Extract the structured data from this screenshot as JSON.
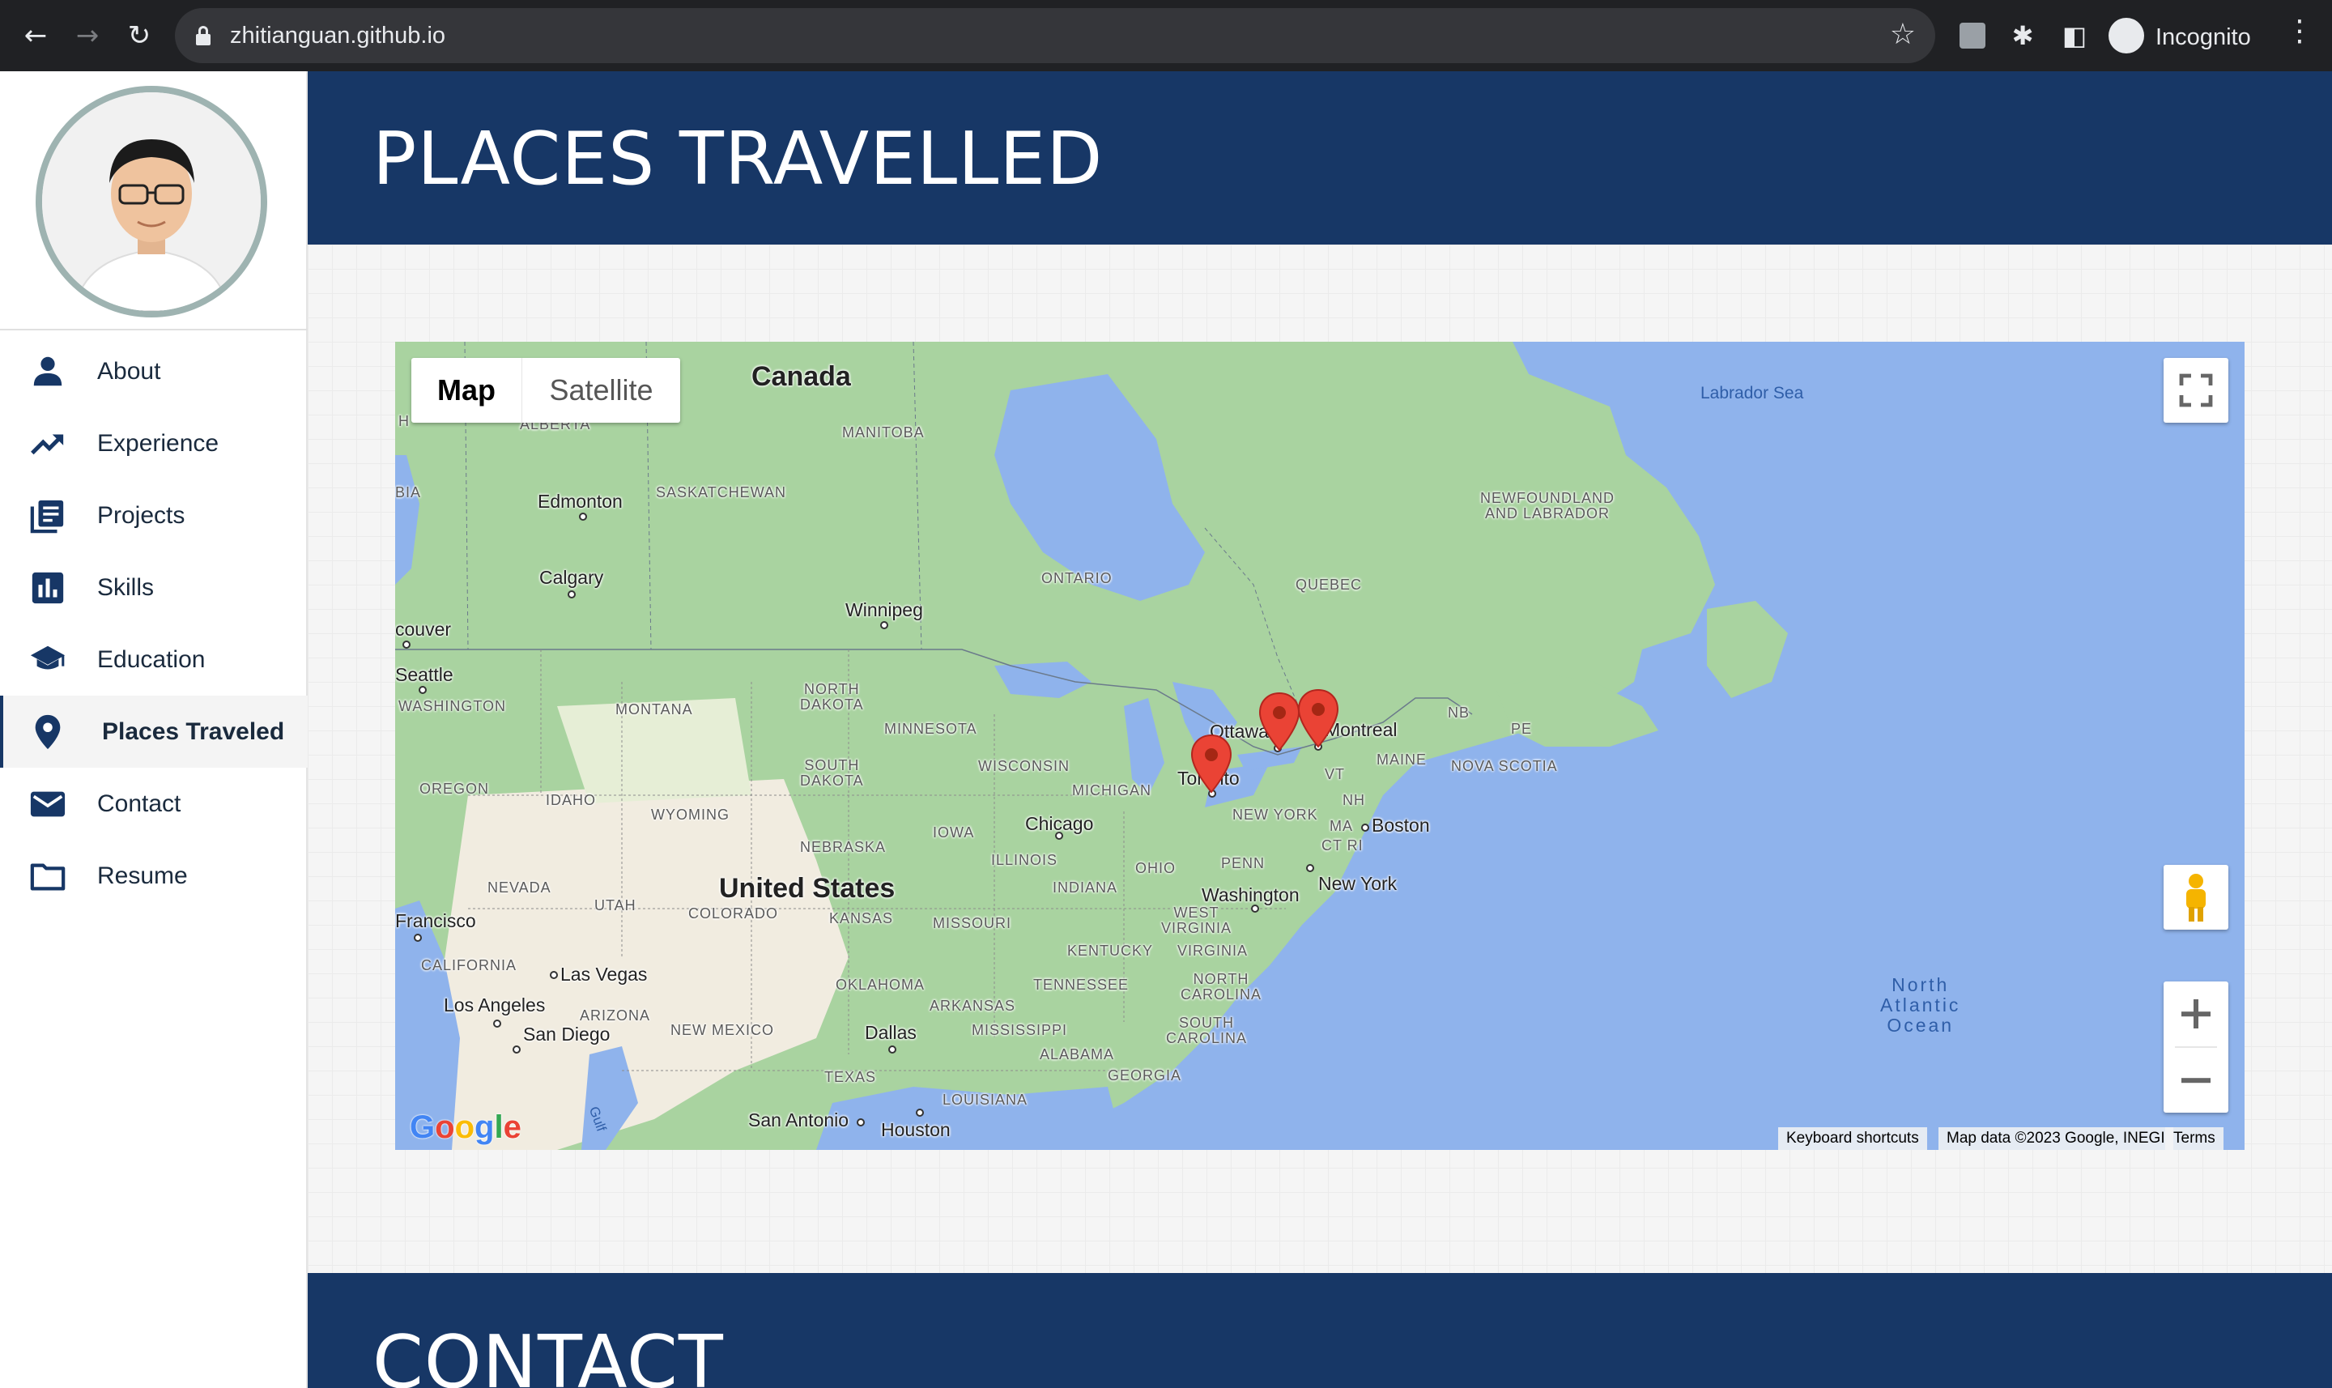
{
  "browser": {
    "url": "zhitianguan.github.io",
    "profile_label": "Incognito",
    "icons": [
      "back-arrow-icon",
      "forward-arrow-icon",
      "reload-icon",
      "lock-icon",
      "star-icon",
      "extension-icon",
      "puzzle-icon",
      "side-panel-icon",
      "incognito-icon",
      "kebab-menu-icon"
    ]
  },
  "sidebar": {
    "items": [
      {
        "label": "About",
        "icon": "person-icon"
      },
      {
        "label": "Experience",
        "icon": "trending-up-icon"
      },
      {
        "label": "Projects",
        "icon": "library-books-icon"
      },
      {
        "label": "Skills",
        "icon": "bar-chart-icon"
      },
      {
        "label": "Education",
        "icon": "graduation-cap-icon"
      },
      {
        "label": "Places Traveled",
        "icon": "location-pin-icon",
        "active": true
      },
      {
        "label": "Contact",
        "icon": "mail-icon"
      },
      {
        "label": "Resume",
        "icon": "folder-icon"
      }
    ]
  },
  "section": {
    "title": "PLACES TRAVELLED"
  },
  "map": {
    "type_buttons": {
      "map": "Map",
      "satellite": "Satellite"
    },
    "selected_type": "Map",
    "labels": {
      "canada": "Canada",
      "united_states": "United States",
      "alberta": "ALBERTA",
      "manitoba": "MANITOBA",
      "saskatchewan": "SASKATCHEWAN",
      "ontario": "ONTARIO",
      "quebec": "QUEBEC",
      "newfoundland": "NEWFOUNDLAND\nAND LABRADOR",
      "labrador_sea": "Labrador Sea",
      "edmonton": "Edmonton",
      "calgary": "Calgary",
      "winnipeg": "Winnipeg",
      "vancouver": "couver",
      "seattle": "Seattle",
      "washington": "WASHINGTON",
      "montana": "MONTANA",
      "north_dakota": "NORTH\nDAKOTA",
      "south_dakota": "SOUTH\nDAKOTA",
      "minnesota": "MINNESOTA",
      "wisconsin": "WISCONSIN",
      "michigan": "MICHIGAN",
      "oregon": "OREGON",
      "idaho": "IDAHO",
      "wyoming": "WYOMING",
      "nebraska": "NEBRASKA",
      "iowa": "IOWA",
      "chicago": "Chicago",
      "illinois": "ILLINOIS",
      "ohio": "OHIO",
      "indiana": "INDIANA",
      "penn": "PENN",
      "new_york_state": "NEW YORK",
      "ottawa": "Ottawa",
      "montreal": "Montreal",
      "toronto": "Toronto",
      "nb": "NB",
      "pe": "PE",
      "maine": "MAINE",
      "nova_scotia": "NOVA SCOTIA",
      "vt": "VT",
      "nh": "NH",
      "ma": "MA",
      "ct_ri": "CT RI",
      "boston": "Boston",
      "new_york": "New York",
      "washington_dc": "Washington",
      "nevada": "NEVADA",
      "utah": "UTAH",
      "colorado": "COLORADO",
      "kansas": "KANSAS",
      "missouri": "MISSOURI",
      "kentucky": "KENTUCKY",
      "west_virginia": "WEST\nVIRGINIA",
      "virginia": "VIRGINIA",
      "san_francisco": "Francisco",
      "california": "CALIFORNIA",
      "las_vegas": "Las Vegas",
      "los_angeles": "Los Angeles",
      "arizona": "ARIZONA",
      "san_diego": "San Diego",
      "new_mexico": "NEW MEXICO",
      "oklahoma": "OKLAHOMA",
      "arkansas": "ARKANSAS",
      "tennessee": "TENNESSEE",
      "north_carolina": "NORTH\nCAROLINA",
      "south_carolina": "SOUTH\nCAROLINA",
      "mississippi": "MISSISSIPPI",
      "alabama": "ALABAMA",
      "georgia": "GEORGIA",
      "dallas": "Dallas",
      "texas": "TEXAS",
      "louisiana": "LOUISIANA",
      "san_antonio": "San Antonio",
      "houston": "Houston",
      "north_atlantic": "North\nAtlantic\nOcean",
      "gulf": "Gulf",
      "bia": "BIA",
      "h": "H"
    },
    "markers": [
      "Ottawa",
      "Montreal",
      "Toronto"
    ],
    "attribution": {
      "shortcuts": "Keyboard shortcuts",
      "data": "Map data ©2023 Google, INEGI",
      "terms": "Terms"
    },
    "logo": "Google",
    "colors": {
      "water": "#8fb3ec",
      "land": "#a8d5a2",
      "pin": "#ea4335"
    }
  },
  "contact": {
    "title": "CONTACT"
  }
}
